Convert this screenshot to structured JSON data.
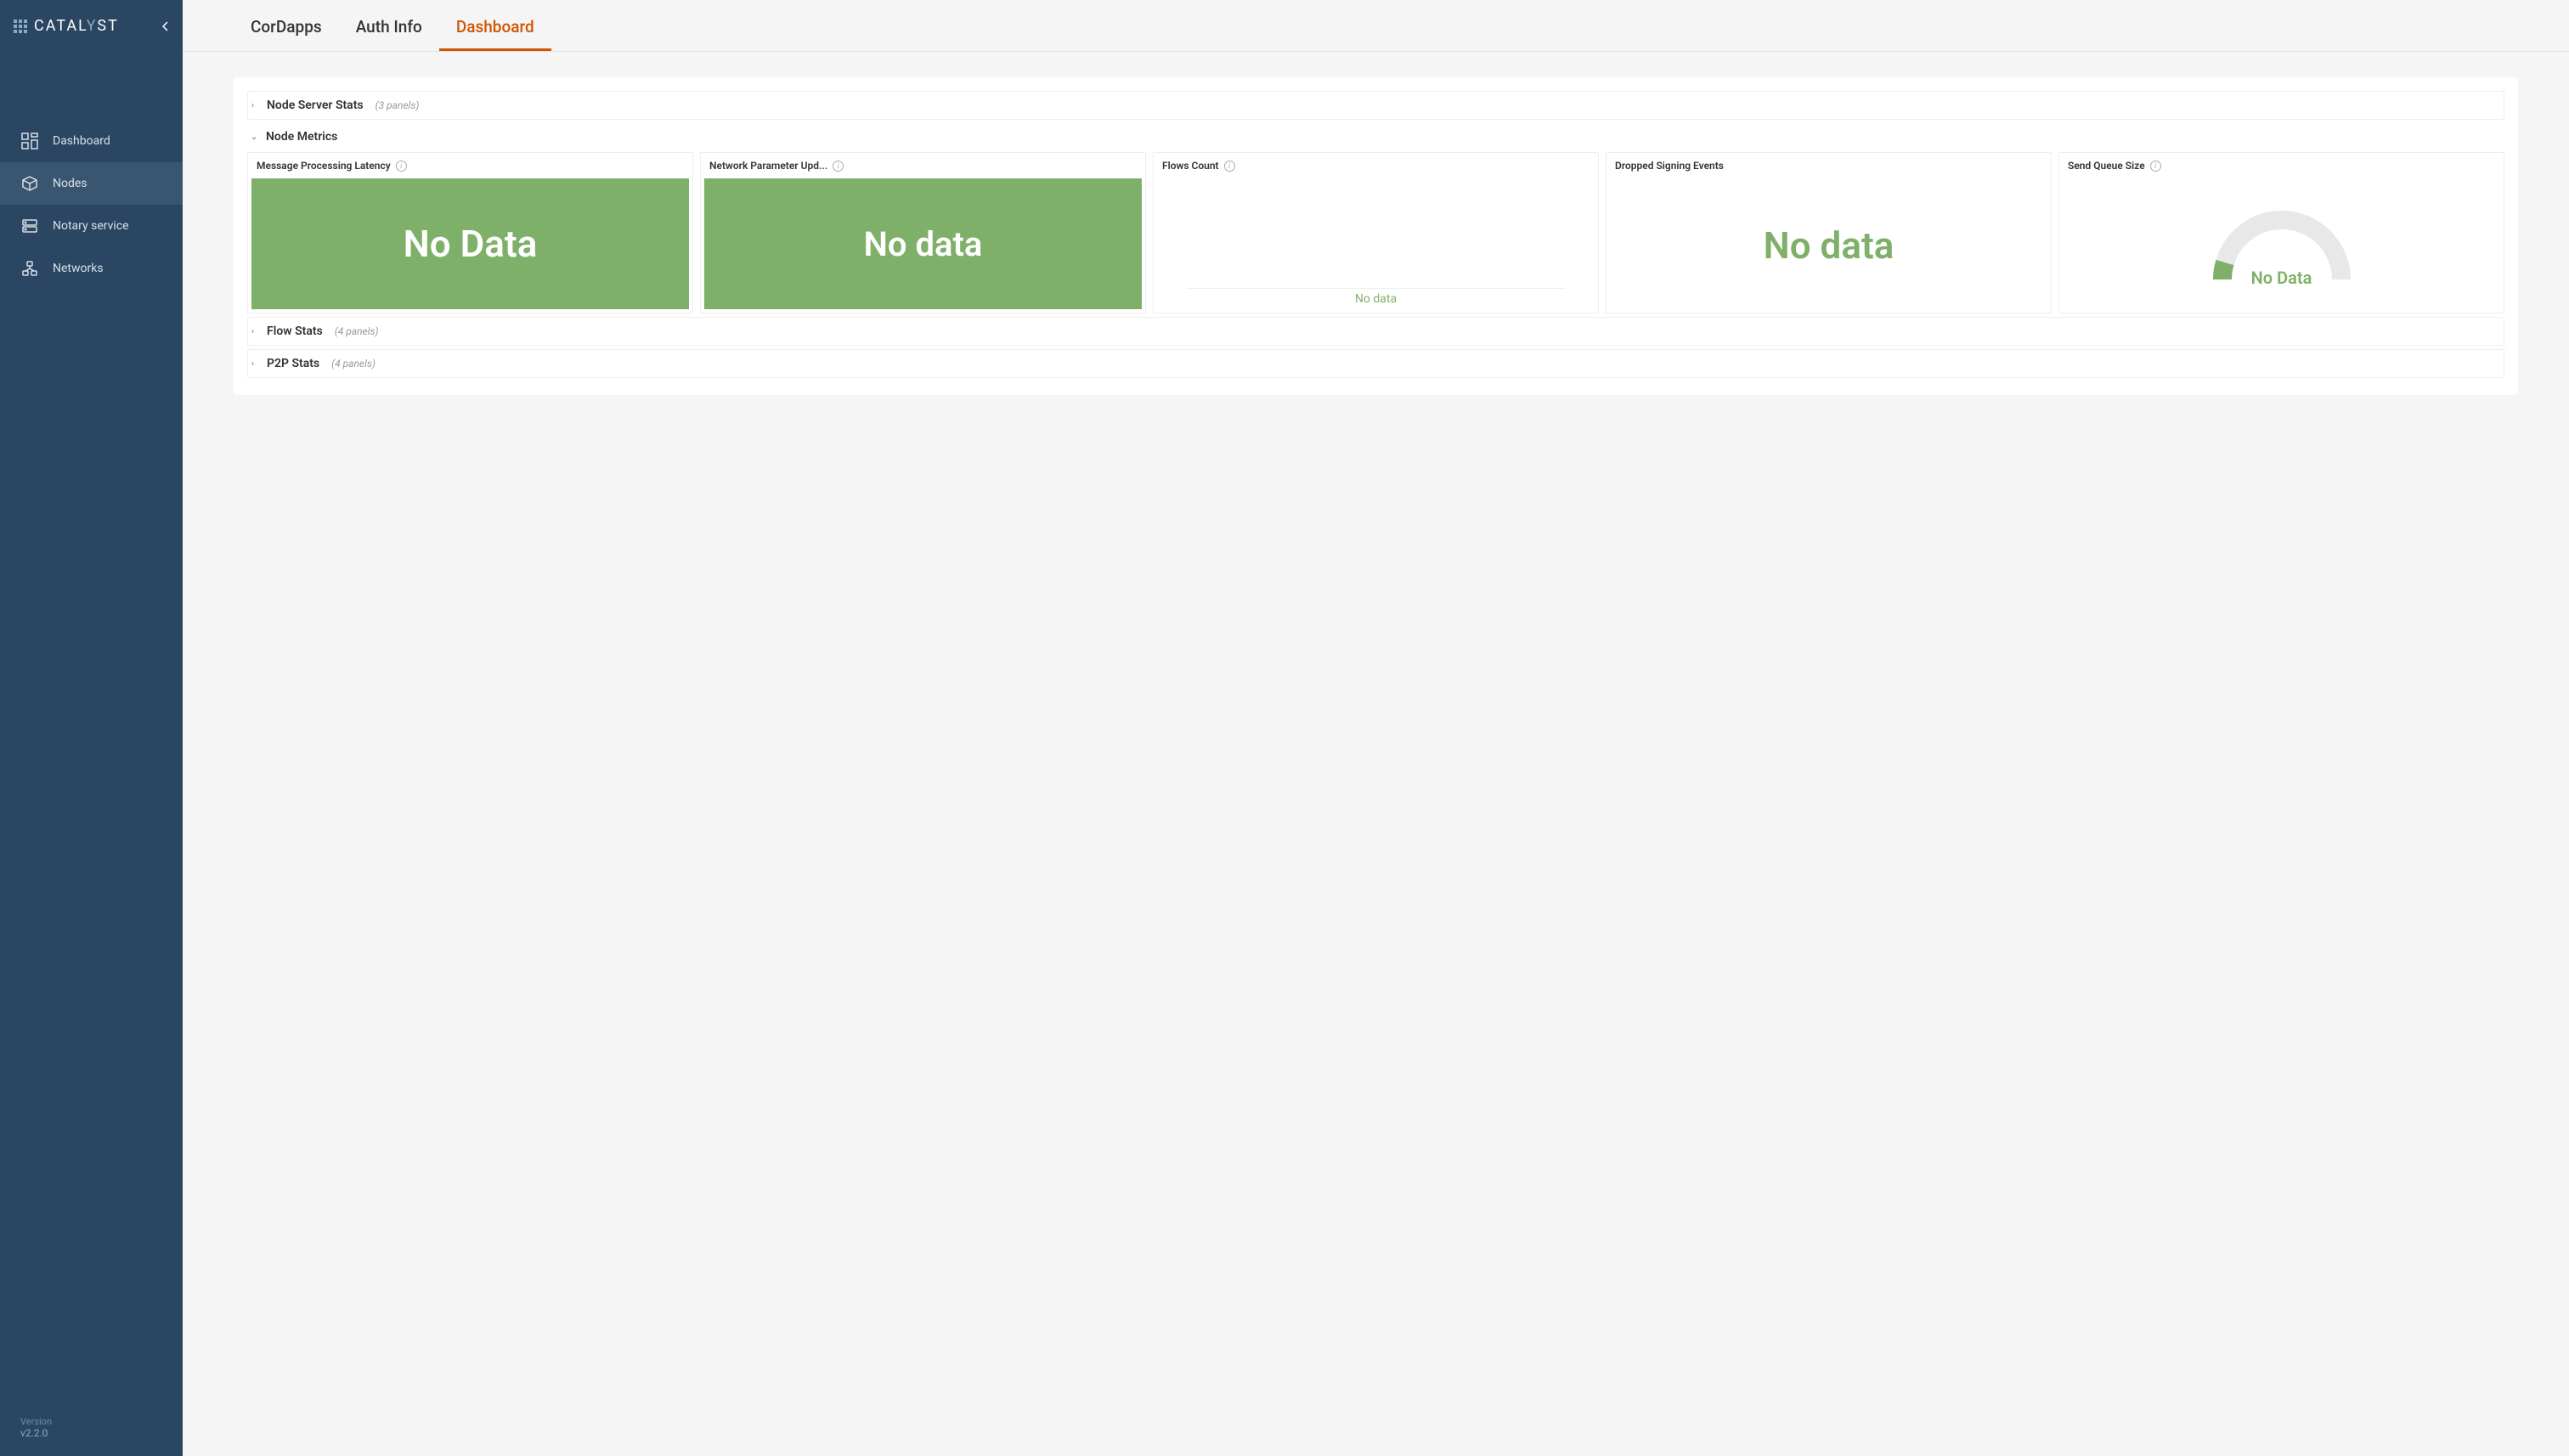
{
  "brand": {
    "name_pre": "CATAL",
    "name_accent": "Y",
    "name_post": "ST"
  },
  "sidebar": {
    "items": [
      {
        "label": "Dashboard",
        "active": false
      },
      {
        "label": "Nodes",
        "active": true
      },
      {
        "label": "Notary service",
        "active": false
      },
      {
        "label": "Networks",
        "active": false
      }
    ],
    "version_label": "Version",
    "version": "v2.2.0"
  },
  "tabs": [
    {
      "label": "CorDapps",
      "active": false
    },
    {
      "label": "Auth Info",
      "active": false
    },
    {
      "label": "Dashboard",
      "active": true
    }
  ],
  "sections": {
    "node_server": {
      "title": "Node Server Stats",
      "meta": "(3 panels)",
      "expanded": false
    },
    "node_metrics": {
      "title": "Node Metrics",
      "expanded": true
    },
    "flow_stats": {
      "title": "Flow Stats",
      "meta": "(4 panels)",
      "expanded": false
    },
    "p2p_stats": {
      "title": "P2P Stats",
      "meta": "(4 panels)",
      "expanded": false
    }
  },
  "panels": {
    "msg_latency": {
      "title": "Message Processing Latency",
      "value": "No Data"
    },
    "net_param": {
      "title": "Network Parameter Upd...",
      "value": "No data"
    },
    "flows_count": {
      "title": "Flows Count",
      "value": "No data"
    },
    "dropped_signing": {
      "title": "Dropped Signing Events",
      "value": "No data"
    },
    "send_queue": {
      "title": "Send Queue Size",
      "value": "No Data"
    }
  }
}
